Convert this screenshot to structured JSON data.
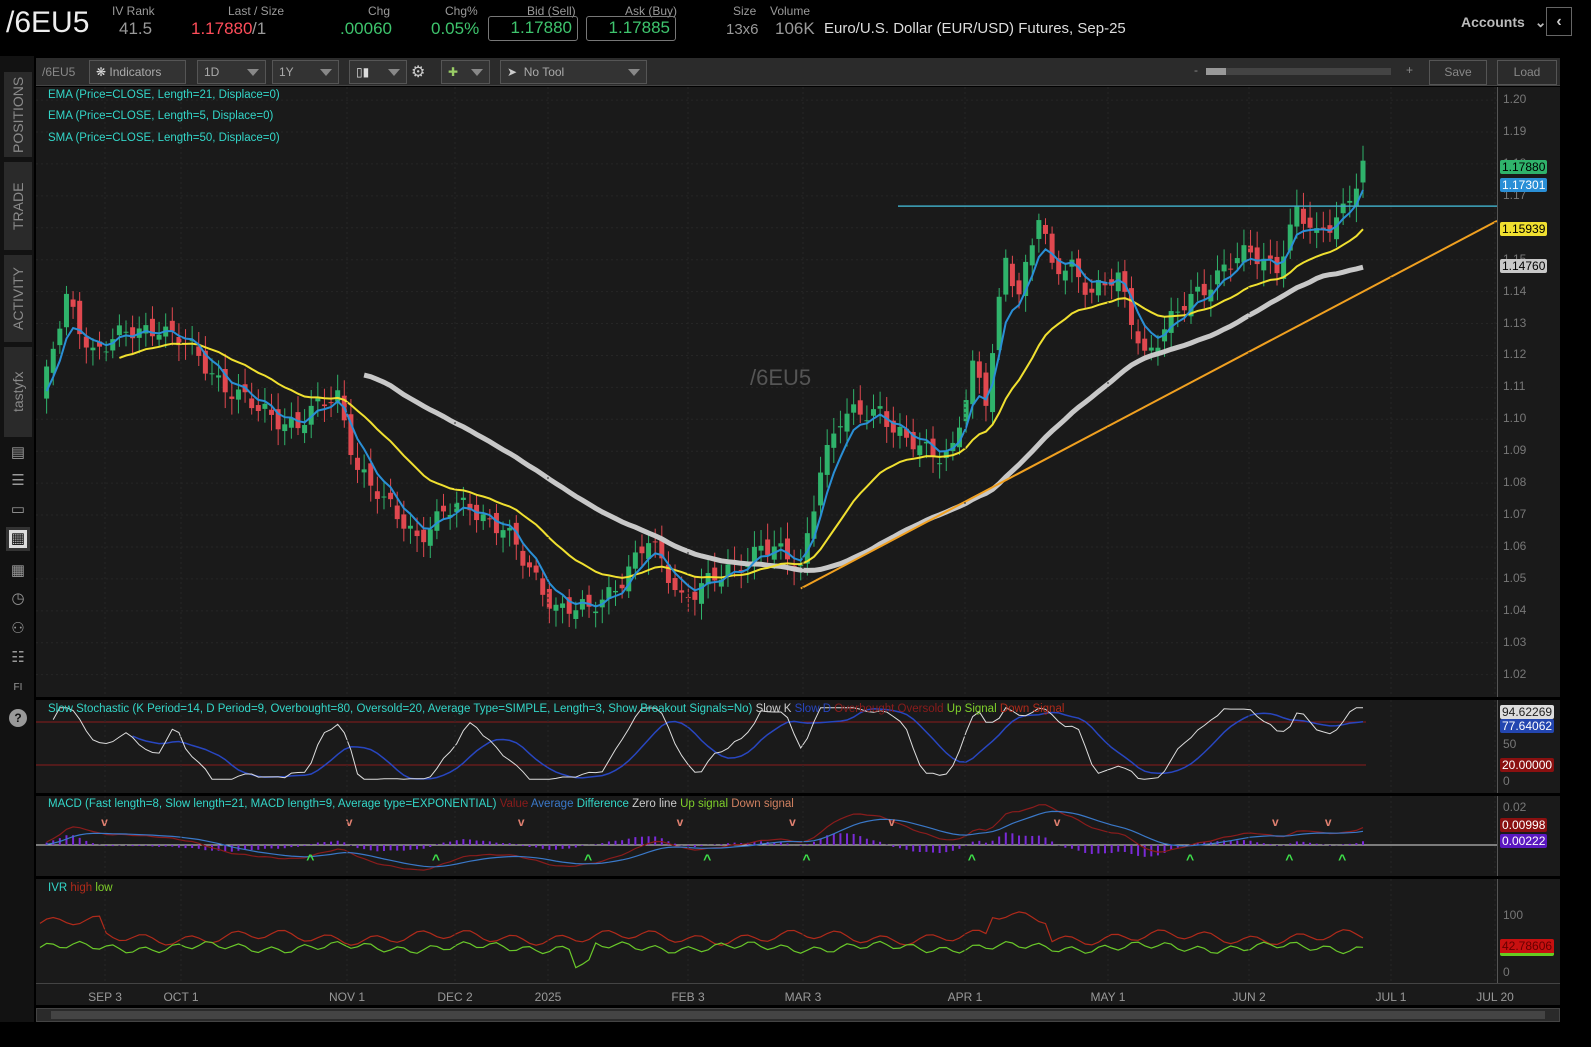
{
  "header": {
    "symbol": "/6EU5",
    "iv_rank_label": "IV Rank",
    "iv_rank": "41.5",
    "last_label": "Last / Size",
    "last": "1.17880",
    "last_size": "/1",
    "chg_label": "Chg",
    "chg": ".00060",
    "chgpct_label": "Chg%",
    "chgpct": "0.05%",
    "bid_label": "Bid (Sell)",
    "bid": "1.17880",
    "ask_label": "Ask (Buy)",
    "ask": "1.17885",
    "size_label": "Size",
    "size": "13x6",
    "volume_label": "Volume",
    "volume": "106K",
    "description": "Euro/U.S. Dollar (EUR/USD) Futures, Sep-25",
    "accounts": "Accounts"
  },
  "sidebar": {
    "tabs": [
      "POSITIONS",
      "TRADE",
      "ACTIVITY",
      "tastyfx"
    ]
  },
  "toolbar": {
    "symbol": "/6EU5",
    "indicators": "Indicators",
    "aggregation": "1D",
    "range": "1Y",
    "drawing_tool": "No Tool",
    "zoom_minus": "-",
    "zoom_plus": "+",
    "save": "Save",
    "load": "Load"
  },
  "studies": [
    "EMA (Price=CLOSE, Length=21, Displace=0)",
    "EMA (Price=CLOSE, Length=5, Displace=0)",
    "SMA (Price=CLOSE, Length=50, Displace=0)"
  ],
  "watermark": "/6EU5",
  "price_axis": [
    "1.20",
    "1.19",
    "1.18",
    "1.17",
    "1.16",
    "1.15",
    "1.14",
    "1.13",
    "1.12",
    "1.11",
    "1.10",
    "1.09",
    "1.08",
    "1.07",
    "1.06",
    "1.05",
    "1.04",
    "1.03",
    "1.02"
  ],
  "price_tags": {
    "last": "1.17880",
    "ema5": "1.17301",
    "ema21": "1.15939",
    "sma50": "1.14760"
  },
  "stoch": {
    "title": "Slow Stochastic (K Period=14, D Period=9, Overbought=80, Oversold=20, Average Type=SIMPLE, Length=3, Show Breakout Signals=No)",
    "legend": [
      "Slow K",
      "Slow D",
      "Overbought",
      "Oversold",
      "Up Signal",
      "Down Signal"
    ],
    "k": "94.62269",
    "d": "77.64062",
    "mid": "50",
    "oversold": "20.00000",
    "zero": "0"
  },
  "macd": {
    "title": "MACD (Fast length=8, Slow length=21, MACD length=9, Average type=EXPONENTIAL)",
    "legend": [
      "Value",
      "Average",
      "Difference",
      "Zero line",
      "Up signal",
      "Down signal"
    ],
    "top": "0.02",
    "value": "0.00998",
    "avg": "0.00222"
  },
  "ivr": {
    "legend": [
      "IVR",
      "high",
      "low"
    ],
    "top": "100",
    "value": "42.78606",
    "zero": "0"
  },
  "x_axis": [
    "SEP 3",
    "OCT 1",
    "NOV 1",
    "DEC 2",
    "2025",
    "FEB 3",
    "MAR 3",
    "APR 1",
    "MAY 1",
    "JUN 2",
    "JUL 1",
    "JUL 20"
  ],
  "colors": {
    "up": "#2fb36b",
    "down": "#e0484f",
    "ema5": "#2a8fd6",
    "ema21": "#f0e030",
    "sma50": "#c8c8c8",
    "trend": "#f0a020",
    "resist": "#3fa8c0"
  },
  "chart_data": {
    "type": "candlestick",
    "price_path": [
      [
        0,
        1.105
      ],
      [
        4,
        1.137
      ],
      [
        8,
        1.122
      ],
      [
        18,
        1.13
      ],
      [
        26,
        1.115
      ],
      [
        33,
        1.102
      ],
      [
        39,
        1.099
      ],
      [
        45,
        1.107
      ],
      [
        48,
        1.086
      ],
      [
        52,
        1.073
      ],
      [
        57,
        1.064
      ],
      [
        61,
        1.07
      ],
      [
        65,
        1.073
      ],
      [
        70,
        1.066
      ],
      [
        73,
        1.055
      ],
      [
        78,
        1.042
      ],
      [
        83,
        1.039
      ],
      [
        88,
        1.051
      ],
      [
        92,
        1.061
      ],
      [
        97,
        1.045
      ],
      [
        103,
        1.05
      ],
      [
        109,
        1.061
      ],
      [
        115,
        1.053
      ],
      [
        118,
        1.086
      ],
      [
        121,
        1.099
      ],
      [
        127,
        1.104
      ],
      [
        131,
        1.092
      ],
      [
        135,
        1.089
      ],
      [
        138,
        1.092
      ],
      [
        141,
        1.115
      ],
      [
        143,
        1.105
      ],
      [
        146,
        1.152
      ],
      [
        148,
        1.14
      ],
      [
        151,
        1.163
      ],
      [
        153,
        1.146
      ],
      [
        156,
        1.149
      ],
      [
        159,
        1.14
      ],
      [
        163,
        1.143
      ],
      [
        167,
        1.121
      ],
      [
        171,
        1.13
      ],
      [
        175,
        1.14
      ],
      [
        179,
        1.148
      ],
      [
        183,
        1.151
      ],
      [
        187,
        1.149
      ],
      [
        190,
        1.165
      ],
      [
        193,
        1.156
      ],
      [
        197,
        1.167
      ],
      [
        200,
        1.1788
      ]
    ],
    "resistance": 1.1668,
    "trendline": [
      [
        115,
        1.047
      ],
      [
        200,
        1.14
      ]
    ],
    "ylim": [
      1.013,
      1.2041
    ]
  }
}
